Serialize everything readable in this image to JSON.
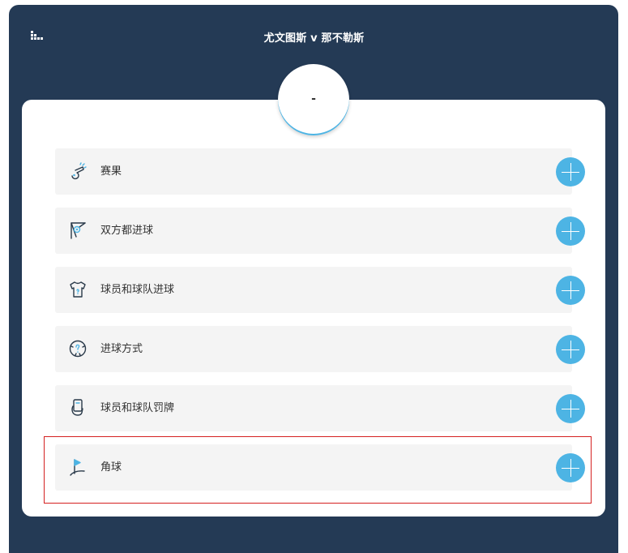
{
  "header": {
    "menu_icon": "bar-chart-menu-icon",
    "match_title": "尤文图斯 v 那不勒斯"
  },
  "score": {
    "value": "-"
  },
  "markets": [
    {
      "label": "赛果",
      "icon": "whistle-icon"
    },
    {
      "label": "双方都进球",
      "icon": "goal-net-icon"
    },
    {
      "label": "球员和球队进球",
      "icon": "jersey-icon"
    },
    {
      "label": "进球方式",
      "icon": "football-question-icon"
    },
    {
      "label": "球员和球队罚牌",
      "icon": "card-hand-icon"
    },
    {
      "label": "角球",
      "icon": "corner-flag-icon"
    }
  ],
  "colors": {
    "panel": "#243a55",
    "accent": "#4db4e4",
    "highlight": "#d42020"
  }
}
